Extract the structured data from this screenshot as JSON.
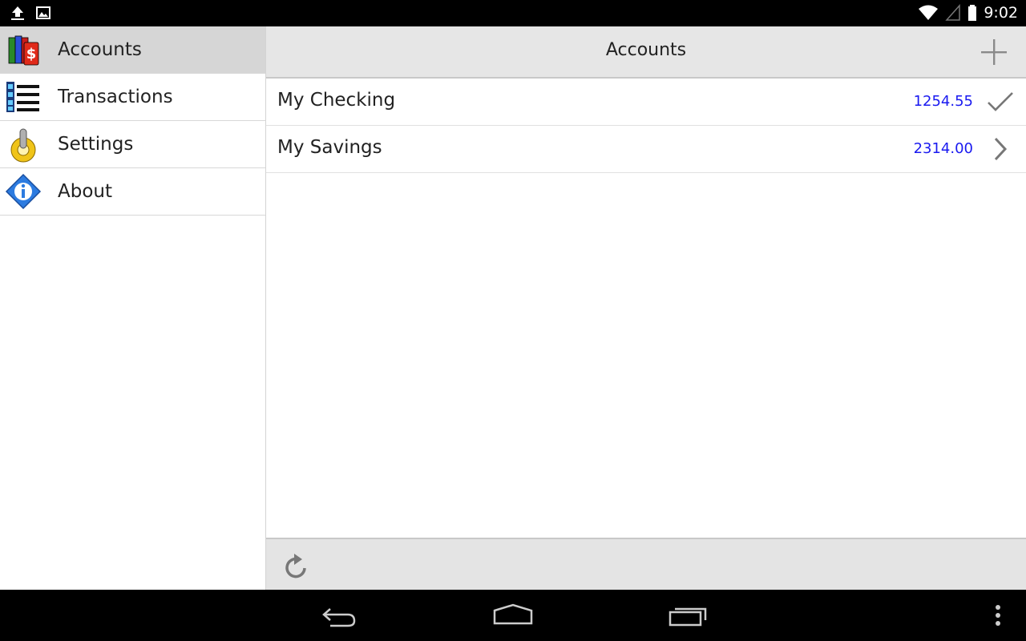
{
  "status_bar": {
    "time": "9:02",
    "left_icons": [
      "upload-icon",
      "image-icon"
    ],
    "right_icons": [
      "wifi-icon",
      "signal-icon",
      "battery-icon"
    ]
  },
  "sidebar": {
    "items": [
      {
        "label": "Accounts",
        "icon": "accounts-books-icon",
        "selected": true
      },
      {
        "label": "Transactions",
        "icon": "transactions-list-icon",
        "selected": false
      },
      {
        "label": "Settings",
        "icon": "settings-gear-icon",
        "selected": false
      },
      {
        "label": "About",
        "icon": "info-icon",
        "selected": false
      }
    ]
  },
  "main": {
    "title": "Accounts",
    "accounts": [
      {
        "name": "My Checking",
        "balance": "1254.55",
        "indicator": "check-icon"
      },
      {
        "name": "My Savings",
        "balance": "2314.00",
        "indicator": "chevron-right-icon"
      }
    ]
  },
  "colors": {
    "balance": "#1a1af0",
    "header_bg": "#e6e6e6",
    "selected_bg": "#d6d6d6"
  },
  "nav_bar": {
    "icons": [
      "back-icon",
      "home-icon",
      "recent-apps-icon",
      "overflow-menu-icon"
    ]
  }
}
